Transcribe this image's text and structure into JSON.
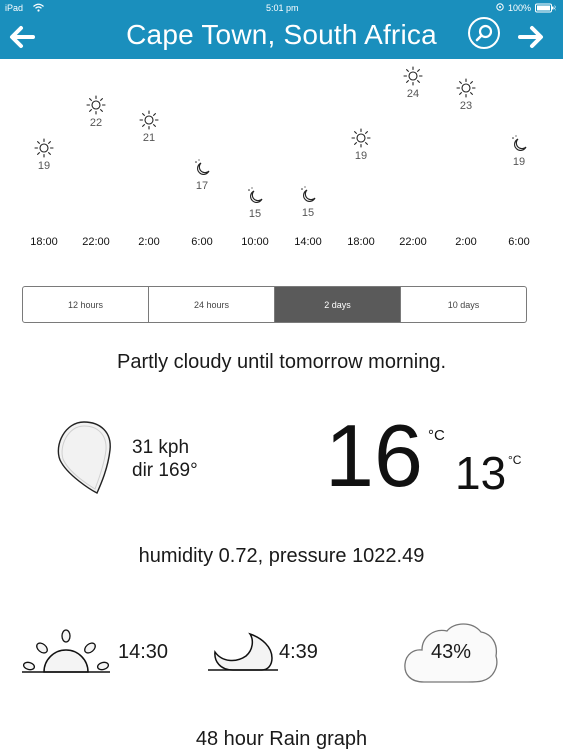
{
  "status": {
    "device": "iPad",
    "time": "5:01 pm",
    "battery": "100%"
  },
  "nav": {
    "title": "Cape Town, South Africa"
  },
  "forecast": [
    {
      "time": "18:00",
      "temp": "19",
      "icon": "sun-icon"
    },
    {
      "time": "22:00",
      "temp": "22",
      "icon": "sun-icon"
    },
    {
      "time": "2:00",
      "temp": "21",
      "icon": "sun-icon"
    },
    {
      "time": "6:00",
      "temp": "17",
      "icon": "moon-icon"
    },
    {
      "time": "10:00",
      "temp": "15",
      "icon": "moon-icon"
    },
    {
      "time": "14:00",
      "temp": "15",
      "icon": "moon-icon"
    },
    {
      "time": "18:00",
      "temp": "19",
      "icon": "sun-icon"
    },
    {
      "time": "22:00",
      "temp": "24",
      "icon": "sun-icon"
    },
    {
      "time": "2:00",
      "temp": "23",
      "icon": "sun-icon"
    },
    {
      "time": "6:00",
      "temp": "19",
      "icon": "moon-icon"
    }
  ],
  "ranges": {
    "items": [
      "12 hours",
      "24 hours",
      "2 days",
      "10 days"
    ],
    "selected": "2 days"
  },
  "summary": "Partly cloudy until tomorrow morning.",
  "wind": {
    "speed": "31 kph",
    "dir": "dir 169°"
  },
  "temperature": {
    "current": "16",
    "low": "13",
    "unit": "°C"
  },
  "meta": "humidity 0.72, pressure 1022.49",
  "astro": {
    "sunrise": "14:30",
    "moonrise": "4:39",
    "cloud_cover": "43%"
  },
  "rain": {
    "title": "48 hour Rain graph"
  }
}
